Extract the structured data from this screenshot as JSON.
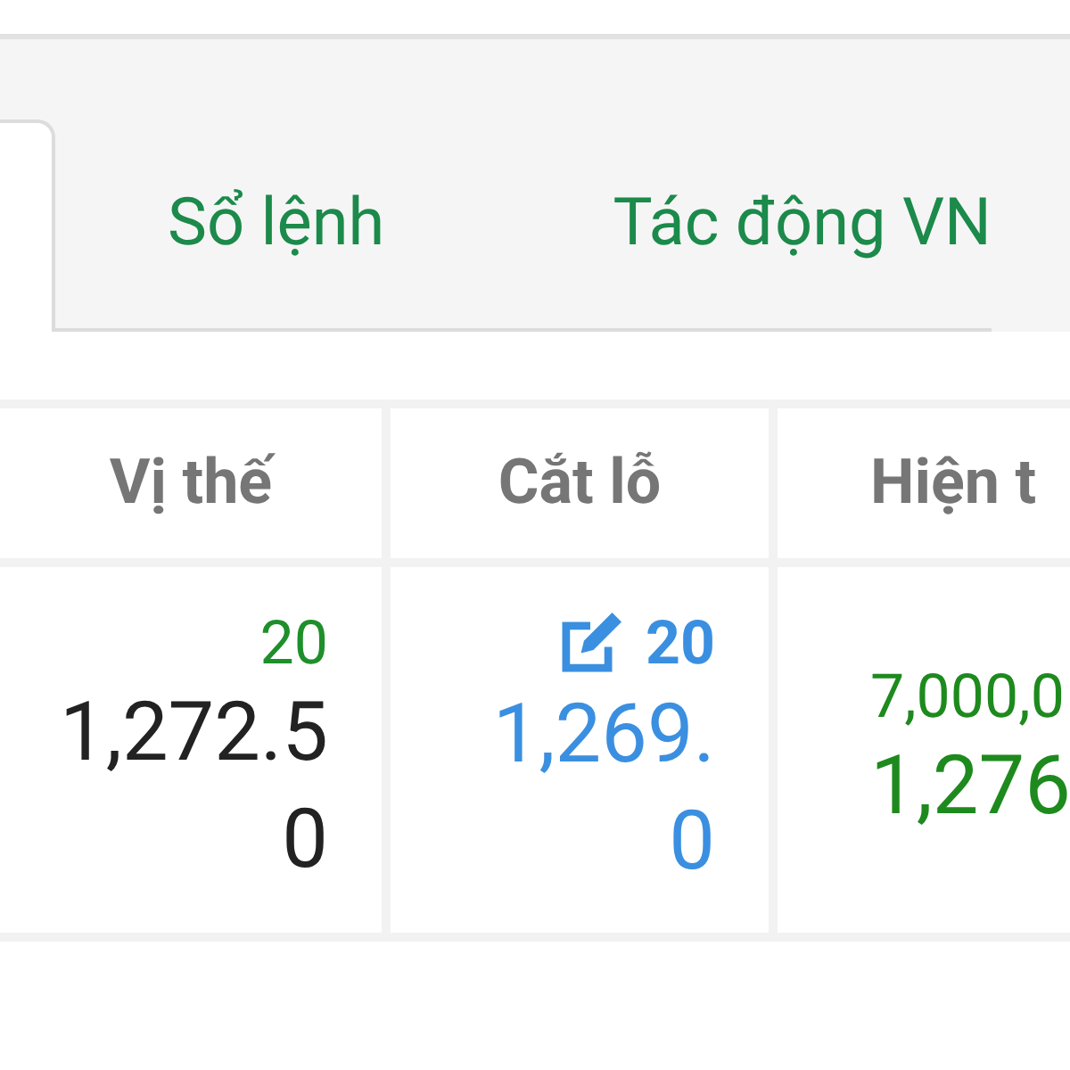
{
  "tabs": [
    {
      "selected": true
    },
    {
      "label": "Sổ lệnh",
      "selected": false
    },
    {
      "label": "Tác động VN",
      "selected": false
    }
  ],
  "table": {
    "columns": [
      "Vị thế",
      "Cắt lỗ",
      "Hiện t"
    ],
    "rows": [
      {
        "cells": [
          {
            "kind": "plain",
            "quantity": "20",
            "price": "1,272.50"
          },
          {
            "kind": "editable",
            "quantity": "20",
            "price": "1,269.0"
          },
          {
            "kind": "market",
            "quantity": "7,000,0",
            "price": "1,276"
          }
        ]
      }
    ]
  }
}
